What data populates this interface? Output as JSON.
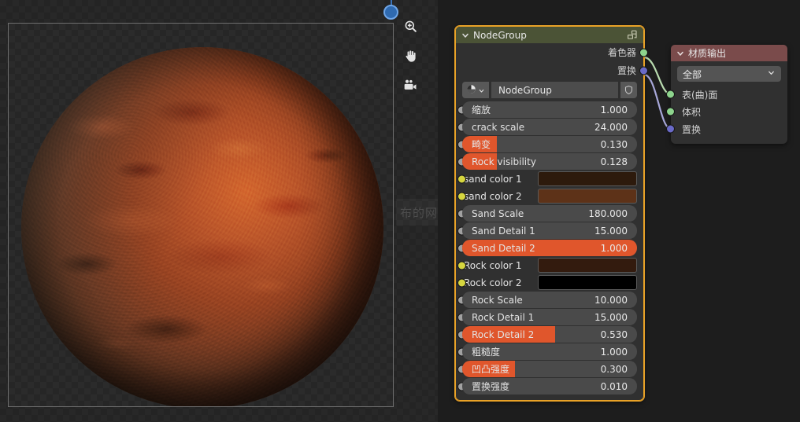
{
  "viewport": {
    "tools": [
      {
        "name": "zoom-tool",
        "icon": "magnifier-plus-icon"
      },
      {
        "name": "pan-tool",
        "icon": "hand-icon"
      },
      {
        "name": "camera-tool",
        "icon": "camera-icon"
      }
    ],
    "watermark": "布的网",
    "nav_gizmo": "view-axis-gizmo"
  },
  "nodes": {
    "node_group": {
      "title": "NodeGroup",
      "header_icon": "node-group-icon",
      "collapse_icon": "chevron-down-icon",
      "outputs": [
        {
          "label": "着色器",
          "socket_color": "#8dd48d"
        },
        {
          "label": "置换",
          "socket_color": "#6a6ac8"
        }
      ],
      "datablock": {
        "browse_icon": "material-sphere-icon",
        "chevron_icon": "chevron-down-icon",
        "name": "NodeGroup",
        "shield_icon": "shield-icon"
      },
      "properties": [
        {
          "label": "缩放",
          "value": "1.000",
          "fill": 0,
          "socket": "grey",
          "type": "value"
        },
        {
          "label": "crack scale",
          "value": "24.000",
          "fill": 0,
          "socket": "grey",
          "type": "value"
        },
        {
          "label": "畸变",
          "value": "0.130",
          "fill": 0.2,
          "socket": "grey",
          "type": "value"
        },
        {
          "label": "Rock visibility",
          "value": "0.128",
          "fill": 0.2,
          "socket": "grey",
          "type": "value"
        },
        {
          "label": "sand color 1",
          "color": "#2d1a0c",
          "socket": "yellow",
          "type": "color"
        },
        {
          "label": "sand color 2",
          "color": "#5d3218",
          "socket": "yellow",
          "type": "color"
        },
        {
          "label": "Sand Scale",
          "value": "180.000",
          "fill": 0,
          "socket": "grey",
          "type": "value"
        },
        {
          "label": "Sand Detail 1",
          "value": "15.000",
          "fill": 0,
          "socket": "grey",
          "type": "value"
        },
        {
          "label": "Sand Detail 2",
          "value": "1.000",
          "fill": 1.0,
          "socket": "grey",
          "type": "value"
        },
        {
          "label": "Rock color 1",
          "color": "#331b0e",
          "socket": "yellow",
          "type": "color"
        },
        {
          "label": "Rock color 2",
          "color": "#000000",
          "socket": "yellow",
          "type": "color"
        },
        {
          "label": "Rock Scale",
          "value": "10.000",
          "fill": 0,
          "socket": "grey",
          "type": "value"
        },
        {
          "label": "Rock Detail 1",
          "value": "15.000",
          "fill": 0,
          "socket": "grey",
          "type": "value"
        },
        {
          "label": "Rock Detail 2",
          "value": "0.530",
          "fill": 0.53,
          "socket": "grey",
          "type": "value"
        },
        {
          "label": "粗糙度",
          "value": "1.000",
          "fill": 0,
          "socket": "grey",
          "type": "value"
        },
        {
          "label": "凹凸强度",
          "value": "0.300",
          "fill": 0.3,
          "socket": "grey",
          "type": "value"
        },
        {
          "label": "置换强度",
          "value": "0.010",
          "fill": 0,
          "socket": "grey",
          "type": "value"
        }
      ]
    },
    "material_output": {
      "title": "材质输出",
      "collapse_icon": "chevron-down-icon",
      "target_select": {
        "value": "全部",
        "chevron_icon": "chevron-down-icon"
      },
      "inputs": [
        {
          "label": "表(曲)面",
          "socket_color": "#8dd48d"
        },
        {
          "label": "体积",
          "socket_color": "#8dd48d"
        },
        {
          "label": "置换",
          "socket_color": "#6a6ac8"
        }
      ]
    }
  },
  "links": [
    {
      "from": "着色器",
      "to": "表(曲)面",
      "color": "#b9dcb0"
    },
    {
      "from": "置换",
      "to": "置换",
      "color": "#a7a7d8"
    }
  ],
  "colors": {
    "node_group_header": "#4b5336",
    "output_header": "#7a4b4b",
    "slider_fill": "#e0562c",
    "selection_outline": "#e9a227",
    "editor_background": "#1d1d1d"
  }
}
